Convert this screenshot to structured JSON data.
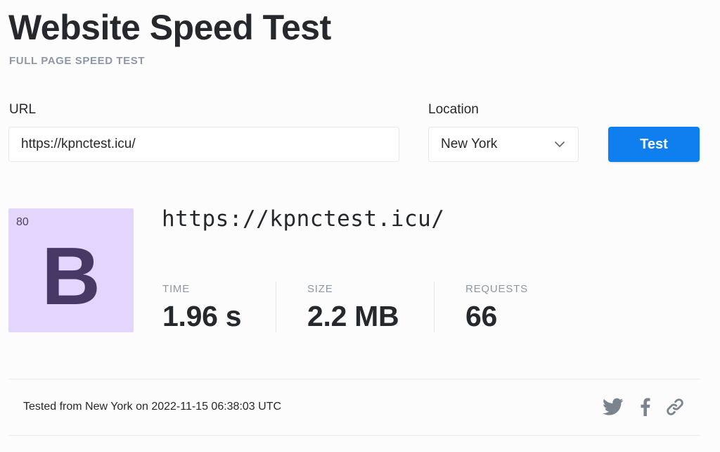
{
  "header": {
    "title": "Website Speed Test",
    "subtitle": "FULL PAGE SPEED TEST"
  },
  "form": {
    "url_label": "URL",
    "url_value": "https://kpnctest.icu/",
    "location_label": "Location",
    "location_value": "New York",
    "test_button": "Test"
  },
  "result": {
    "score": "80",
    "grade": "B",
    "url": "https://kpnctest.icu/",
    "stats": {
      "time_label": "TIME",
      "time_value": "1.96 s",
      "size_label": "SIZE",
      "size_value": "2.2 MB",
      "requests_label": "REQUESTS",
      "requests_value": "66"
    }
  },
  "footer": {
    "tested_text": "Tested from New York on 2022-11-15 06:38:03 UTC",
    "share_icons": [
      "twitter-icon",
      "facebook-icon",
      "link-icon"
    ]
  },
  "colors": {
    "accent": "#0f7ff0",
    "grade_bg": "#e3d5fb",
    "grade_text": "#473865",
    "muted": "#8d98a4"
  }
}
